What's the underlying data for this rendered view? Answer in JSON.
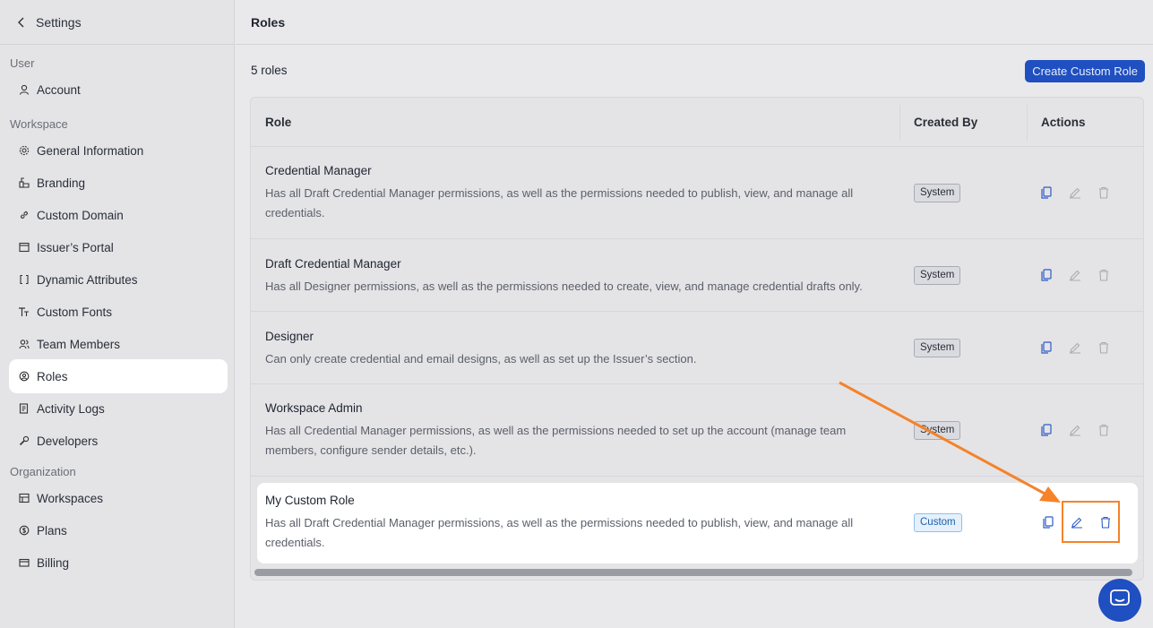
{
  "sidebar": {
    "back_label": "Settings",
    "sections": {
      "user": "User",
      "workspace": "Workspace",
      "organization": "Organization"
    },
    "items": {
      "account": "Account",
      "general": "General Information",
      "branding": "Branding",
      "domain": "Custom Domain",
      "portal": "Issuer’s Portal",
      "dynamic": "Dynamic Attributes",
      "fonts": "Custom Fonts",
      "team": "Team Members",
      "roles": "Roles",
      "logs": "Activity Logs",
      "developers": "Developers",
      "workspaces": "Workspaces",
      "plans": "Plans",
      "billing": "Billing"
    }
  },
  "main": {
    "title": "Roles",
    "count": "5 roles",
    "create_button": "Create Custom Role",
    "columns": {
      "role": "Role",
      "created_by": "Created By",
      "actions": "Actions"
    },
    "rows": [
      {
        "title": "Credential Manager",
        "desc": "Has all Draft Credential Manager permissions, as well as the permissions needed to publish, view, and manage all credentials.",
        "badge": "System"
      },
      {
        "title": "Draft Credential Manager",
        "desc": "Has all Designer permissions, as well as the permissions needed to create, view, and manage credential drafts only.",
        "badge": "System"
      },
      {
        "title": "Designer",
        "desc": "Can only create credential and email designs, as well as set up the Issuer’s section.",
        "badge": "System"
      },
      {
        "title": "Workspace Admin",
        "desc": "Has all Credential Manager permissions, as well as the permissions needed to set up the account (manage team members, configure sender details, etc.).",
        "badge": "System"
      },
      {
        "title": "My Custom Role",
        "desc": "Has all Draft Credential Manager permissions, as well as the permissions needed to publish, view, and manage all credentials.",
        "badge": "Custom"
      }
    ]
  },
  "colors": {
    "accent": "#1f4fc0",
    "annotation": "#f5832a"
  }
}
